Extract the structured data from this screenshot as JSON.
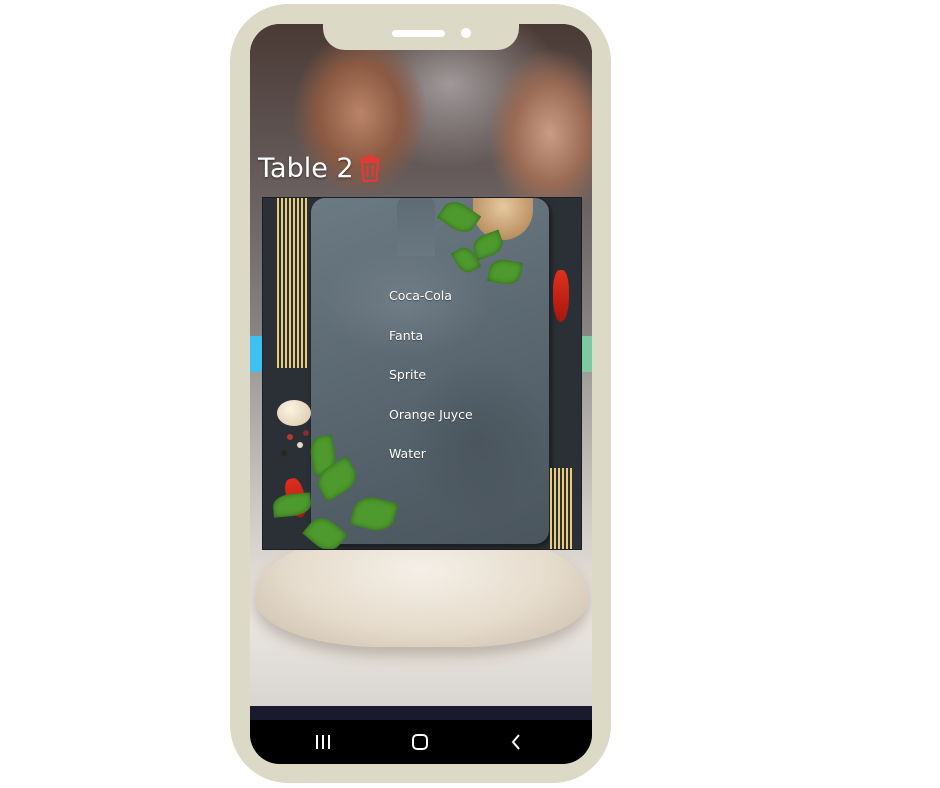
{
  "screen": {
    "title": "Table 2",
    "delete_icon": "trash-icon"
  },
  "menu": {
    "items": [
      {
        "label": "Coca-Cola"
      },
      {
        "label": "Fanta"
      },
      {
        "label": "Sprite"
      },
      {
        "label": "Orange Juyce"
      },
      {
        "label": "Water"
      }
    ]
  },
  "navigation": {
    "recents_icon": "recents-icon",
    "home_icon": "home-icon",
    "back_icon": "back-icon"
  },
  "colors": {
    "trash_icon": "#e53935",
    "title_text": "#ffffff",
    "left_accent": "#3ec0f0",
    "right_accent": "#7fc9a2",
    "phone_frame": "#dcd9c6"
  }
}
